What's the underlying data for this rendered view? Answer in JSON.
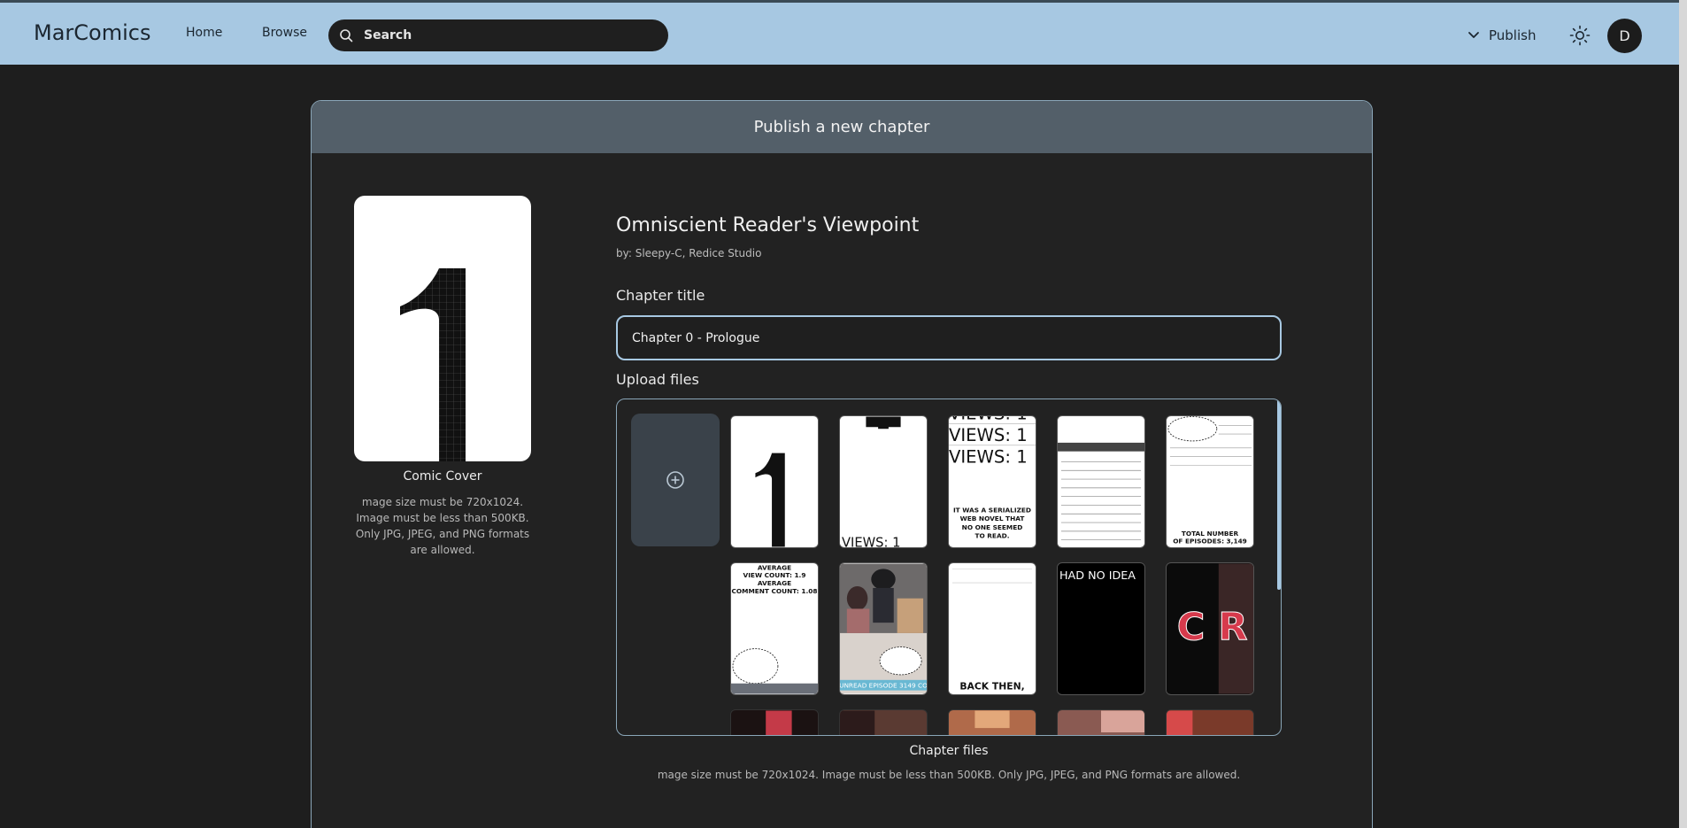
{
  "nav": {
    "brand": "MarComics",
    "home": "Home",
    "browse": "Browse",
    "search_placeholder": "Search",
    "publish": "Publish",
    "avatar_initial": "D",
    "accent": "#a7c8e2"
  },
  "card": {
    "header": "Publish a new chapter",
    "cover_caption": "Comic Cover",
    "cover_note": "mage size must be 720x1024. Image must be less than 500KB. Only JPG, JPEG, and PNG formats are allowed.",
    "comic_title": "Omniscient Reader's Viewpoint",
    "comic_author": "by: Sleepy-C, Redice Studio",
    "chapter_title_label": "Chapter title",
    "chapter_title_value": "Chapter 0 - Prologue",
    "upload_label": "Upload files",
    "files_caption": "Chapter files",
    "files_note": "mage size must be 720x1024. Image must be less than 500KB. Only JPG, JPEG, and PNG formats are allowed."
  },
  "pages": [
    {
      "name": "page-1",
      "text": []
    },
    {
      "name": "page-2",
      "text": [
        "VIEWS: 1"
      ]
    },
    {
      "name": "page-3",
      "text": [
        "VIEWS: 1",
        "VIEWS: 1",
        "VIEWS: 1",
        "IT WAS A SERIALIZED",
        "WEB NOVEL THAT",
        "NO ONE SEEMED",
        "TO READ."
      ]
    },
    {
      "name": "page-4",
      "text": []
    },
    {
      "name": "page-5",
      "text": [
        "TOTAL NUMBER",
        "OF EPISODES: 3,149"
      ]
    },
    {
      "name": "page-6",
      "text": [
        "AVERAGE",
        "VIEW COUNT: 1.9",
        "AVERAGE",
        "COMMENT COUNT: 1.08"
      ]
    },
    {
      "name": "page-7",
      "text": [
        "UNREAD EPISODE 3149 CO"
      ]
    },
    {
      "name": "page-8",
      "text": [
        "BACK THEN,"
      ]
    },
    {
      "name": "page-9",
      "text": [
        "HAD NO IDEA"
      ]
    },
    {
      "name": "page-10",
      "text": [
        "C R"
      ]
    }
  ]
}
